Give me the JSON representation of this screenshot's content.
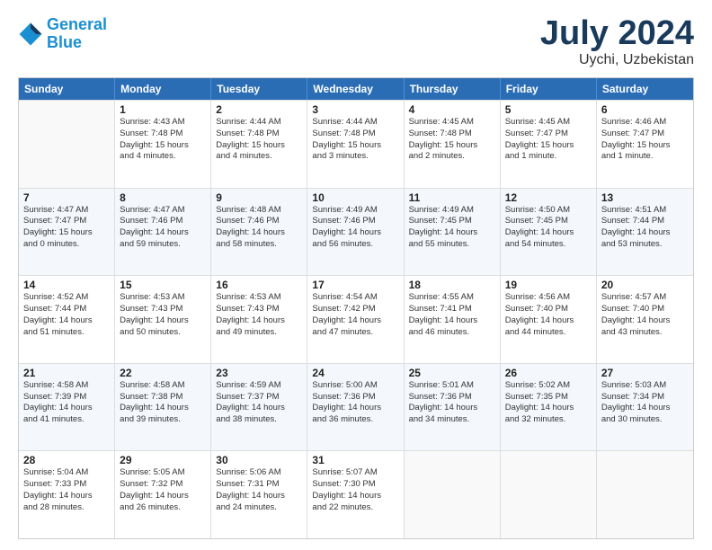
{
  "header": {
    "logo_general": "General",
    "logo_blue": "Blue",
    "month": "July 2024",
    "location": "Uychi, Uzbekistan"
  },
  "days_of_week": [
    "Sunday",
    "Monday",
    "Tuesday",
    "Wednesday",
    "Thursday",
    "Friday",
    "Saturday"
  ],
  "weeks": [
    [
      {
        "day": "",
        "info": ""
      },
      {
        "day": "1",
        "info": "Sunrise: 4:43 AM\nSunset: 7:48 PM\nDaylight: 15 hours\nand 4 minutes."
      },
      {
        "day": "2",
        "info": "Sunrise: 4:44 AM\nSunset: 7:48 PM\nDaylight: 15 hours\nand 4 minutes."
      },
      {
        "day": "3",
        "info": "Sunrise: 4:44 AM\nSunset: 7:48 PM\nDaylight: 15 hours\nand 3 minutes."
      },
      {
        "day": "4",
        "info": "Sunrise: 4:45 AM\nSunset: 7:48 PM\nDaylight: 15 hours\nand 2 minutes."
      },
      {
        "day": "5",
        "info": "Sunrise: 4:45 AM\nSunset: 7:47 PM\nDaylight: 15 hours\nand 1 minute."
      },
      {
        "day": "6",
        "info": "Sunrise: 4:46 AM\nSunset: 7:47 PM\nDaylight: 15 hours\nand 1 minute."
      }
    ],
    [
      {
        "day": "7",
        "info": "Sunrise: 4:47 AM\nSunset: 7:47 PM\nDaylight: 15 hours\nand 0 minutes."
      },
      {
        "day": "8",
        "info": "Sunrise: 4:47 AM\nSunset: 7:46 PM\nDaylight: 14 hours\nand 59 minutes."
      },
      {
        "day": "9",
        "info": "Sunrise: 4:48 AM\nSunset: 7:46 PM\nDaylight: 14 hours\nand 58 minutes."
      },
      {
        "day": "10",
        "info": "Sunrise: 4:49 AM\nSunset: 7:46 PM\nDaylight: 14 hours\nand 56 minutes."
      },
      {
        "day": "11",
        "info": "Sunrise: 4:49 AM\nSunset: 7:45 PM\nDaylight: 14 hours\nand 55 minutes."
      },
      {
        "day": "12",
        "info": "Sunrise: 4:50 AM\nSunset: 7:45 PM\nDaylight: 14 hours\nand 54 minutes."
      },
      {
        "day": "13",
        "info": "Sunrise: 4:51 AM\nSunset: 7:44 PM\nDaylight: 14 hours\nand 53 minutes."
      }
    ],
    [
      {
        "day": "14",
        "info": "Sunrise: 4:52 AM\nSunset: 7:44 PM\nDaylight: 14 hours\nand 51 minutes."
      },
      {
        "day": "15",
        "info": "Sunrise: 4:53 AM\nSunset: 7:43 PM\nDaylight: 14 hours\nand 50 minutes."
      },
      {
        "day": "16",
        "info": "Sunrise: 4:53 AM\nSunset: 7:43 PM\nDaylight: 14 hours\nand 49 minutes."
      },
      {
        "day": "17",
        "info": "Sunrise: 4:54 AM\nSunset: 7:42 PM\nDaylight: 14 hours\nand 47 minutes."
      },
      {
        "day": "18",
        "info": "Sunrise: 4:55 AM\nSunset: 7:41 PM\nDaylight: 14 hours\nand 46 minutes."
      },
      {
        "day": "19",
        "info": "Sunrise: 4:56 AM\nSunset: 7:40 PM\nDaylight: 14 hours\nand 44 minutes."
      },
      {
        "day": "20",
        "info": "Sunrise: 4:57 AM\nSunset: 7:40 PM\nDaylight: 14 hours\nand 43 minutes."
      }
    ],
    [
      {
        "day": "21",
        "info": "Sunrise: 4:58 AM\nSunset: 7:39 PM\nDaylight: 14 hours\nand 41 minutes."
      },
      {
        "day": "22",
        "info": "Sunrise: 4:58 AM\nSunset: 7:38 PM\nDaylight: 14 hours\nand 39 minutes."
      },
      {
        "day": "23",
        "info": "Sunrise: 4:59 AM\nSunset: 7:37 PM\nDaylight: 14 hours\nand 38 minutes."
      },
      {
        "day": "24",
        "info": "Sunrise: 5:00 AM\nSunset: 7:36 PM\nDaylight: 14 hours\nand 36 minutes."
      },
      {
        "day": "25",
        "info": "Sunrise: 5:01 AM\nSunset: 7:36 PM\nDaylight: 14 hours\nand 34 minutes."
      },
      {
        "day": "26",
        "info": "Sunrise: 5:02 AM\nSunset: 7:35 PM\nDaylight: 14 hours\nand 32 minutes."
      },
      {
        "day": "27",
        "info": "Sunrise: 5:03 AM\nSunset: 7:34 PM\nDaylight: 14 hours\nand 30 minutes."
      }
    ],
    [
      {
        "day": "28",
        "info": "Sunrise: 5:04 AM\nSunset: 7:33 PM\nDaylight: 14 hours\nand 28 minutes."
      },
      {
        "day": "29",
        "info": "Sunrise: 5:05 AM\nSunset: 7:32 PM\nDaylight: 14 hours\nand 26 minutes."
      },
      {
        "day": "30",
        "info": "Sunrise: 5:06 AM\nSunset: 7:31 PM\nDaylight: 14 hours\nand 24 minutes."
      },
      {
        "day": "31",
        "info": "Sunrise: 5:07 AM\nSunset: 7:30 PM\nDaylight: 14 hours\nand 22 minutes."
      },
      {
        "day": "",
        "info": ""
      },
      {
        "day": "",
        "info": ""
      },
      {
        "day": "",
        "info": ""
      }
    ]
  ]
}
